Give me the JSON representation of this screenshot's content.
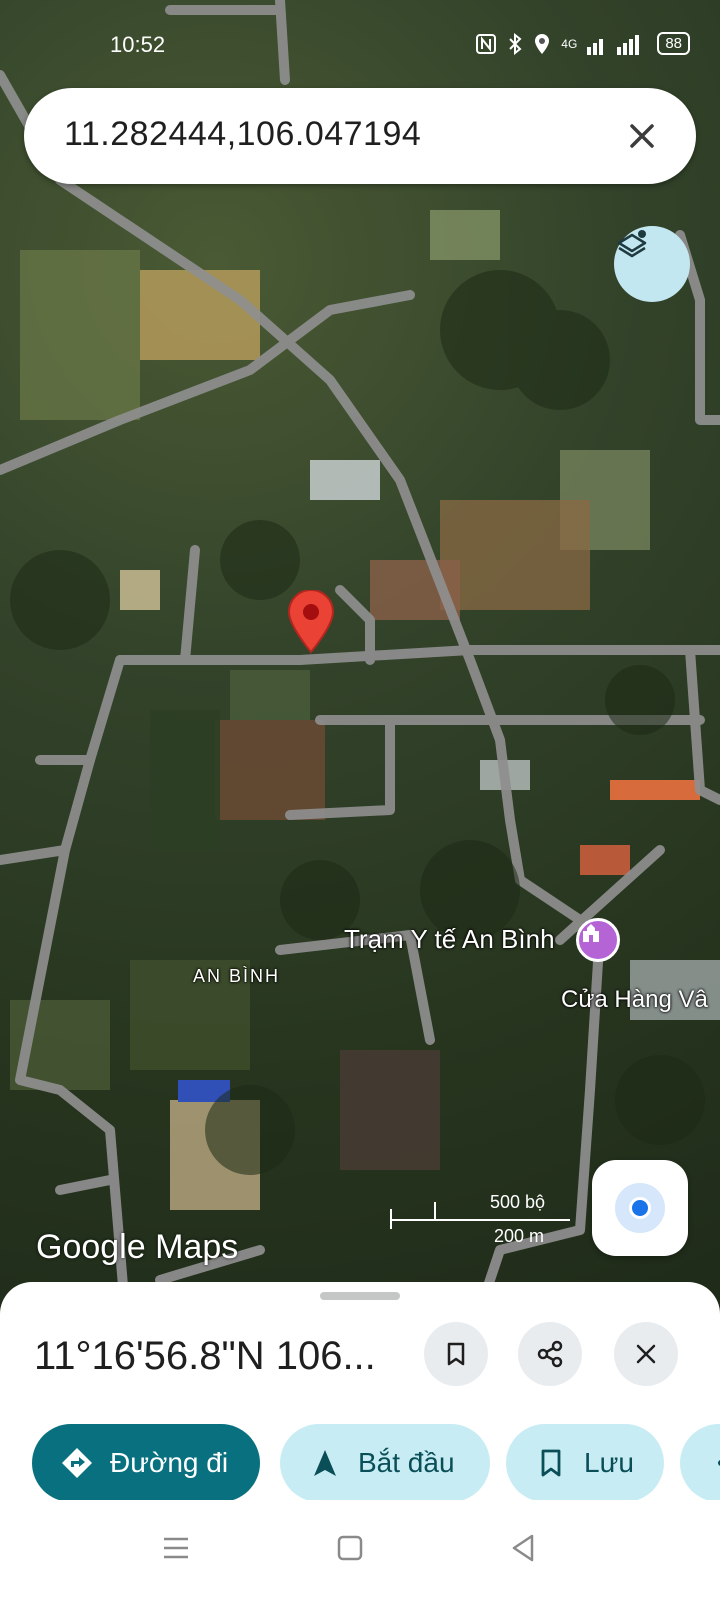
{
  "status_bar": {
    "time": "10:52",
    "network": "4G",
    "battery": "88"
  },
  "search": {
    "value": "11.282444,106.047194"
  },
  "map": {
    "labels": {
      "health_station": "Trạm Y tế An Bình",
      "store": "Cửa Hàng Vâ",
      "area": "AN BÌNH"
    },
    "watermark": "Google Maps",
    "scale": {
      "feet": "500 bộ",
      "meters": "200 m"
    }
  },
  "sheet": {
    "title": "11°16'56.8\"N 106...",
    "actions": {
      "directions": "Đường đi",
      "start": "Bắt đầu",
      "save": "Lưu"
    }
  },
  "colors": {
    "accent": "#08707e",
    "chip_bg": "#c8ecf3",
    "pin": "#ea4335",
    "poi": "#b564d6"
  }
}
